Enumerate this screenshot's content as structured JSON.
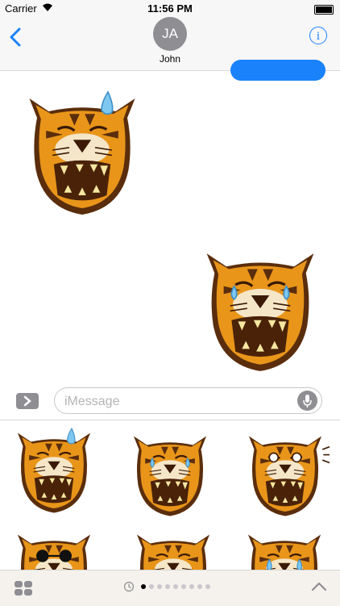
{
  "status": {
    "carrier": "Carrier",
    "time": "11:56 PM"
  },
  "nav": {
    "avatar_initials": "JA",
    "contact_name": "John",
    "info_glyph": "i",
    "back_icon": "chevron-left-icon"
  },
  "conversation": {
    "sent_message": "",
    "stickers": [
      {
        "name": "tiger-sweating",
        "side": "left"
      },
      {
        "name": "tiger-crying-laughing",
        "side": "right"
      }
    ]
  },
  "composer": {
    "placeholder": "iMessage",
    "expand_icon": "chevron-right-icon",
    "mic_icon": "microphone-icon"
  },
  "sticker_drawer": {
    "stickers": [
      "tiger-sweating",
      "tiger-crying-laughing",
      "tiger-surprised",
      "tiger-sunglasses",
      "tiger-grinning",
      "tiger-crying"
    ]
  },
  "bottom_toolbar": {
    "apps_icon": "app-grid-icon",
    "recents_icon": "clock-icon",
    "page_count": 9,
    "current_page": 1,
    "collapse_icon": "chevron-up-icon"
  },
  "colors": {
    "accent": "#1a82fb",
    "tiger_orange": "#e8951a",
    "tiger_dark": "#5a2d0c",
    "avatar_gray": "#8e8e93"
  }
}
